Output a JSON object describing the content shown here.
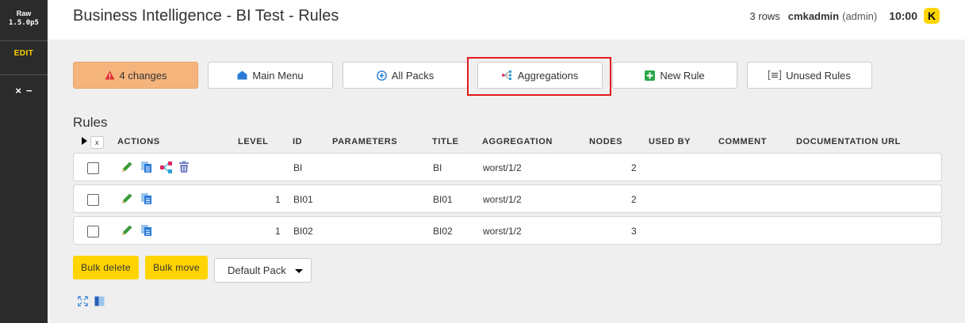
{
  "sidebar": {
    "line1": "Raw",
    "line2": "1.5.0p5",
    "edit_label": "EDIT",
    "ctrl_close": "×",
    "ctrl_min": "−"
  },
  "header": {
    "title": "Business Intelligence - BI Test - Rules",
    "rows_count": "3 rows",
    "user": "cmkadmin",
    "role": "(admin)",
    "time": "10:00",
    "logo_letter": "K"
  },
  "toolbar": {
    "changes": "4 changes",
    "main_menu": "Main Menu",
    "all_packs": "All Packs",
    "aggregations": "Aggregations",
    "new_rule": "New Rule",
    "unused_rules": "Unused Rules"
  },
  "table": {
    "title": "Rules",
    "x_label": "x",
    "columns": {
      "actions": "ACTIONS",
      "level": "LEVEL",
      "id": "ID",
      "parameters": "PARAMETERS",
      "title": "TITLE",
      "aggregation": "AGGREGATION",
      "nodes": "NODES",
      "used_by": "USED BY",
      "comment": "COMMENT",
      "doc_url": "DOCUMENTATION URL"
    },
    "rows": [
      {
        "level": "",
        "id": "BI",
        "title": "BI",
        "aggregation": "worst/1/2",
        "nodes": "2"
      },
      {
        "level": "1",
        "id": "BI01",
        "title": "BI01",
        "aggregation": "worst/1/2",
        "nodes": "2"
      },
      {
        "level": "1",
        "id": "BI02",
        "title": "BI02",
        "aggregation": "worst/1/2",
        "nodes": "3"
      }
    ]
  },
  "bottom": {
    "bulk_delete": "Bulk delete",
    "bulk_move": "Bulk move",
    "pack_selected": "Default Pack"
  },
  "colors": {
    "accent_yellow": "#ffd400",
    "changes_orange": "#f4b47c",
    "highlight_red": "#e21b1b"
  }
}
